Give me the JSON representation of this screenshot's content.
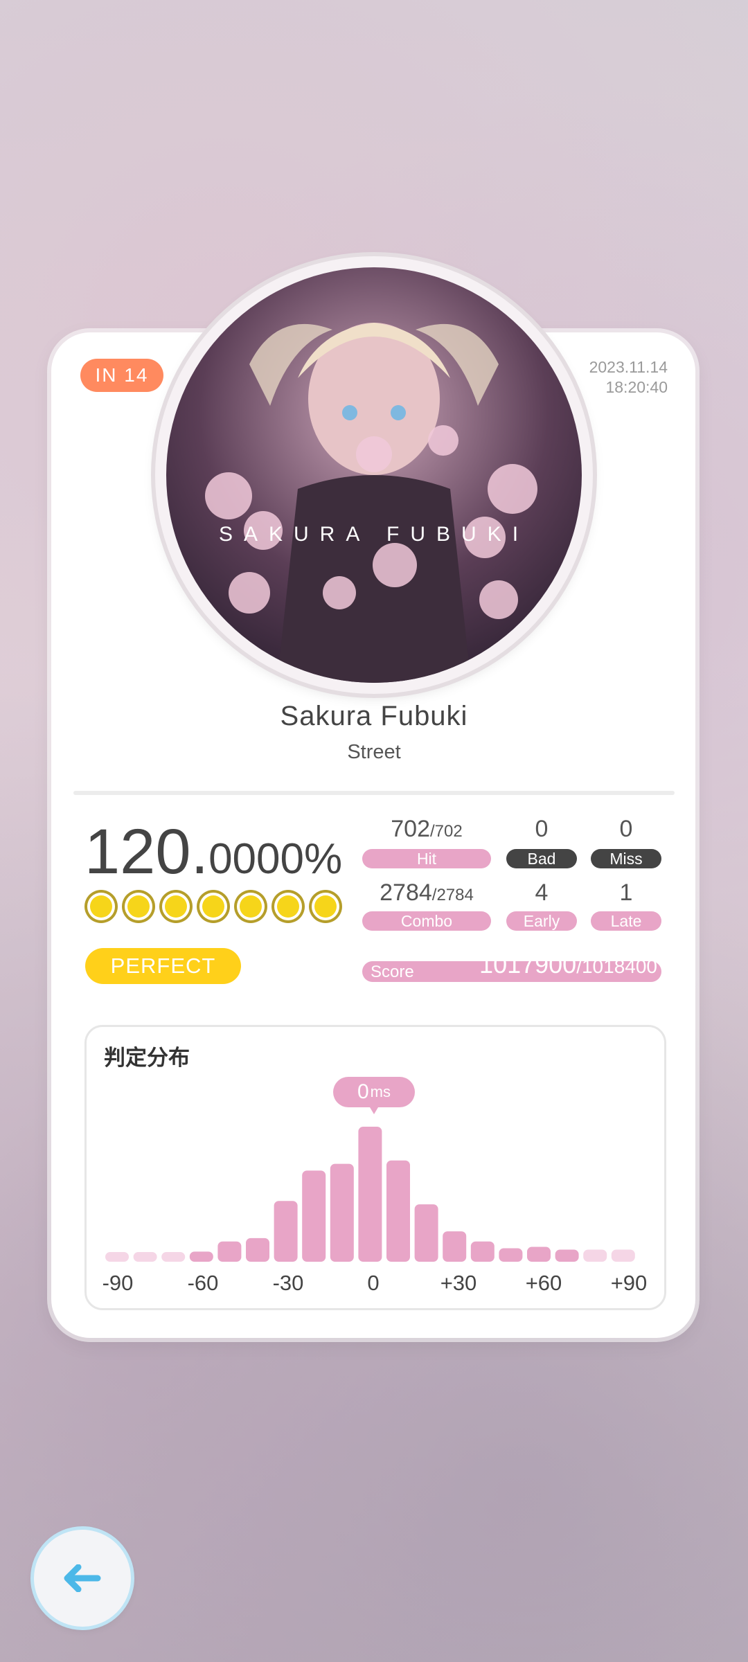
{
  "header": {
    "difficulty_label": "IN 14",
    "date": "2023.11.14",
    "time": "18:20:40"
  },
  "song": {
    "title": "Sakura Fubuki",
    "genre": "Street",
    "jacket_text": "SAKURA FUBUKI"
  },
  "result": {
    "accuracy_big": "120.",
    "accuracy_small": "0000%",
    "stars": 7,
    "rank": "PERFECT"
  },
  "stats": {
    "hit": {
      "value": "702",
      "total": "/702",
      "label": "Hit"
    },
    "bad": {
      "value": "0",
      "label": "Bad"
    },
    "miss": {
      "value": "0",
      "label": "Miss"
    },
    "combo": {
      "value": "2784",
      "total": "/2784",
      "label": "Combo"
    },
    "early": {
      "value": "4",
      "label": "Early"
    },
    "late": {
      "value": "1",
      "label": "Late"
    },
    "score": {
      "label": "Score",
      "value": "1017900",
      "max": "/1018400"
    }
  },
  "distribution": {
    "title": "判定分布",
    "marker_value": "0",
    "marker_unit": "ms",
    "tick_labels": [
      "-90",
      "-60",
      "-30",
      "0",
      "+30",
      "+60",
      "+90"
    ]
  },
  "chart_data": {
    "type": "bar",
    "x": [
      -90,
      -80,
      -70,
      -60,
      -50,
      -40,
      -30,
      -20,
      -10,
      0,
      10,
      20,
      30,
      40,
      50,
      60,
      70,
      80,
      90
    ],
    "values": [
      1,
      1,
      1,
      1.5,
      3,
      3.5,
      9,
      13.5,
      14.5,
      20,
      15,
      8.5,
      4.5,
      3,
      2,
      2.2,
      1.8,
      1.8,
      1.8
    ],
    "ylim": [
      0,
      20
    ],
    "color": "#e8a5c7"
  },
  "colors": {
    "accent_pink": "#e8a5c7",
    "badge_orange": "#ff8a5f",
    "rank_yellow": "#ffd01a",
    "dark_pill": "#444444",
    "back_arrow": "#4cb8e8"
  },
  "back_button_icon": "arrow-left-icon"
}
